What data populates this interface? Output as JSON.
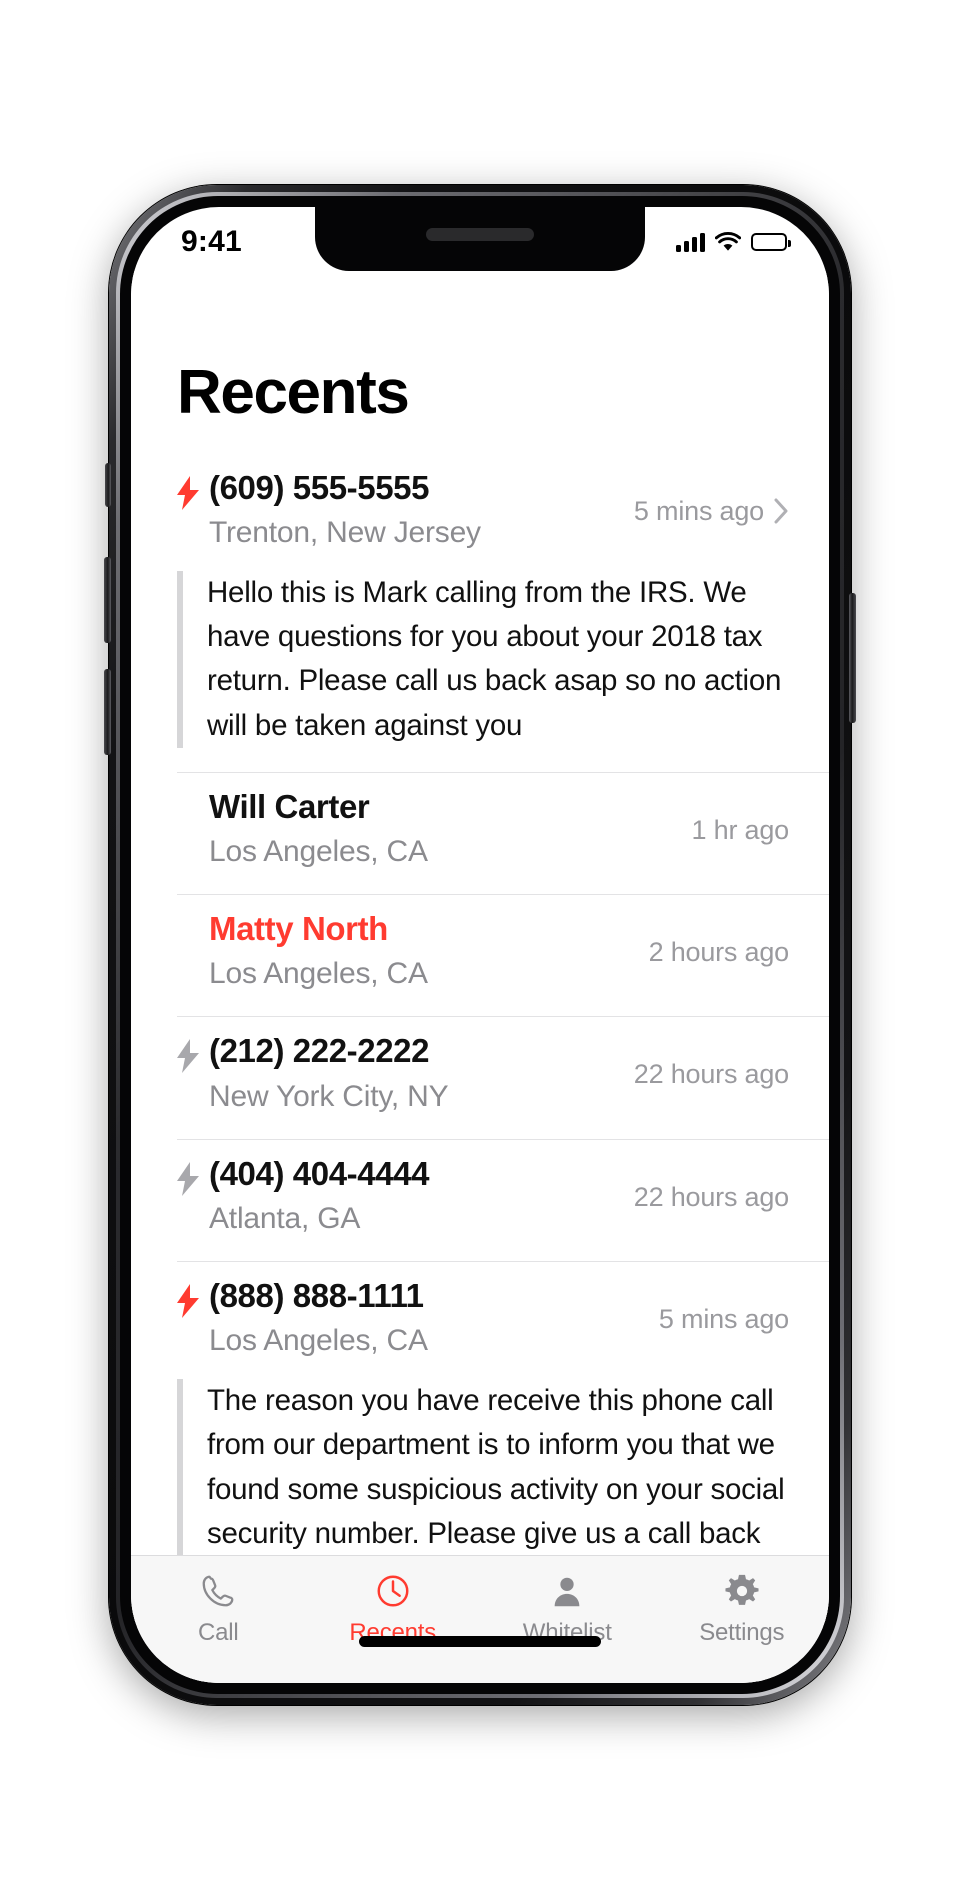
{
  "status_bar": {
    "time": "9:41",
    "signal_icon": "cellular-signal-icon",
    "wifi_icon": "wifi-icon",
    "battery_icon": "battery-icon"
  },
  "header": {
    "title": "Recents"
  },
  "colors": {
    "accent_red": "#ff3b30",
    "text_primary": "#111111",
    "text_secondary": "#8b8b8f",
    "time_text": "#9a9a9e",
    "separator": "#e3e3e5",
    "quote_bar": "#d6d6d8",
    "tabbar_bg": "#f7f7f7"
  },
  "calls": [
    {
      "name": "(609) 555-5555",
      "location": "Trenton, New Jersey",
      "time": "5 mins ago",
      "flag": "red",
      "flagged_name": false,
      "has_chevron": true,
      "transcript": "Hello this is Mark calling from the IRS. We have questions for you about your 2018 tax return. Please call us back asap so no action will be taken against you"
    },
    {
      "name": "Will Carter",
      "location": "Los Angeles, CA",
      "time": "1 hr ago",
      "flag": "none",
      "flagged_name": false,
      "has_chevron": false,
      "transcript": ""
    },
    {
      "name": "Matty North",
      "location": "Los Angeles, CA",
      "time": "2 hours ago",
      "flag": "none",
      "flagged_name": true,
      "has_chevron": false,
      "transcript": ""
    },
    {
      "name": "(212) 222-2222",
      "location": "New York City, NY",
      "time": "22 hours ago",
      "flag": "gray",
      "flagged_name": false,
      "has_chevron": false,
      "transcript": ""
    },
    {
      "name": "(404) 404-4444",
      "location": "Atlanta, GA",
      "time": "22 hours ago",
      "flag": "gray",
      "flagged_name": false,
      "has_chevron": false,
      "transcript": ""
    },
    {
      "name": "(888) 888-1111",
      "location": "Los Angeles, CA",
      "time": "5 mins ago",
      "flag": "red",
      "flagged_name": false,
      "has_chevron": false,
      "transcript": "The reason you have receive this phone call from our department is to inform you that we found some suspicious activity on your social security number. Please give us a call back …"
    }
  ],
  "tabbar": {
    "items": [
      {
        "label": "Call",
        "icon": "phone-icon",
        "active": false
      },
      {
        "label": "Recents",
        "icon": "clock-icon",
        "active": true
      },
      {
        "label": "Whitelist",
        "icon": "person-icon",
        "active": false
      },
      {
        "label": "Settings",
        "icon": "gear-icon",
        "active": false
      }
    ]
  }
}
